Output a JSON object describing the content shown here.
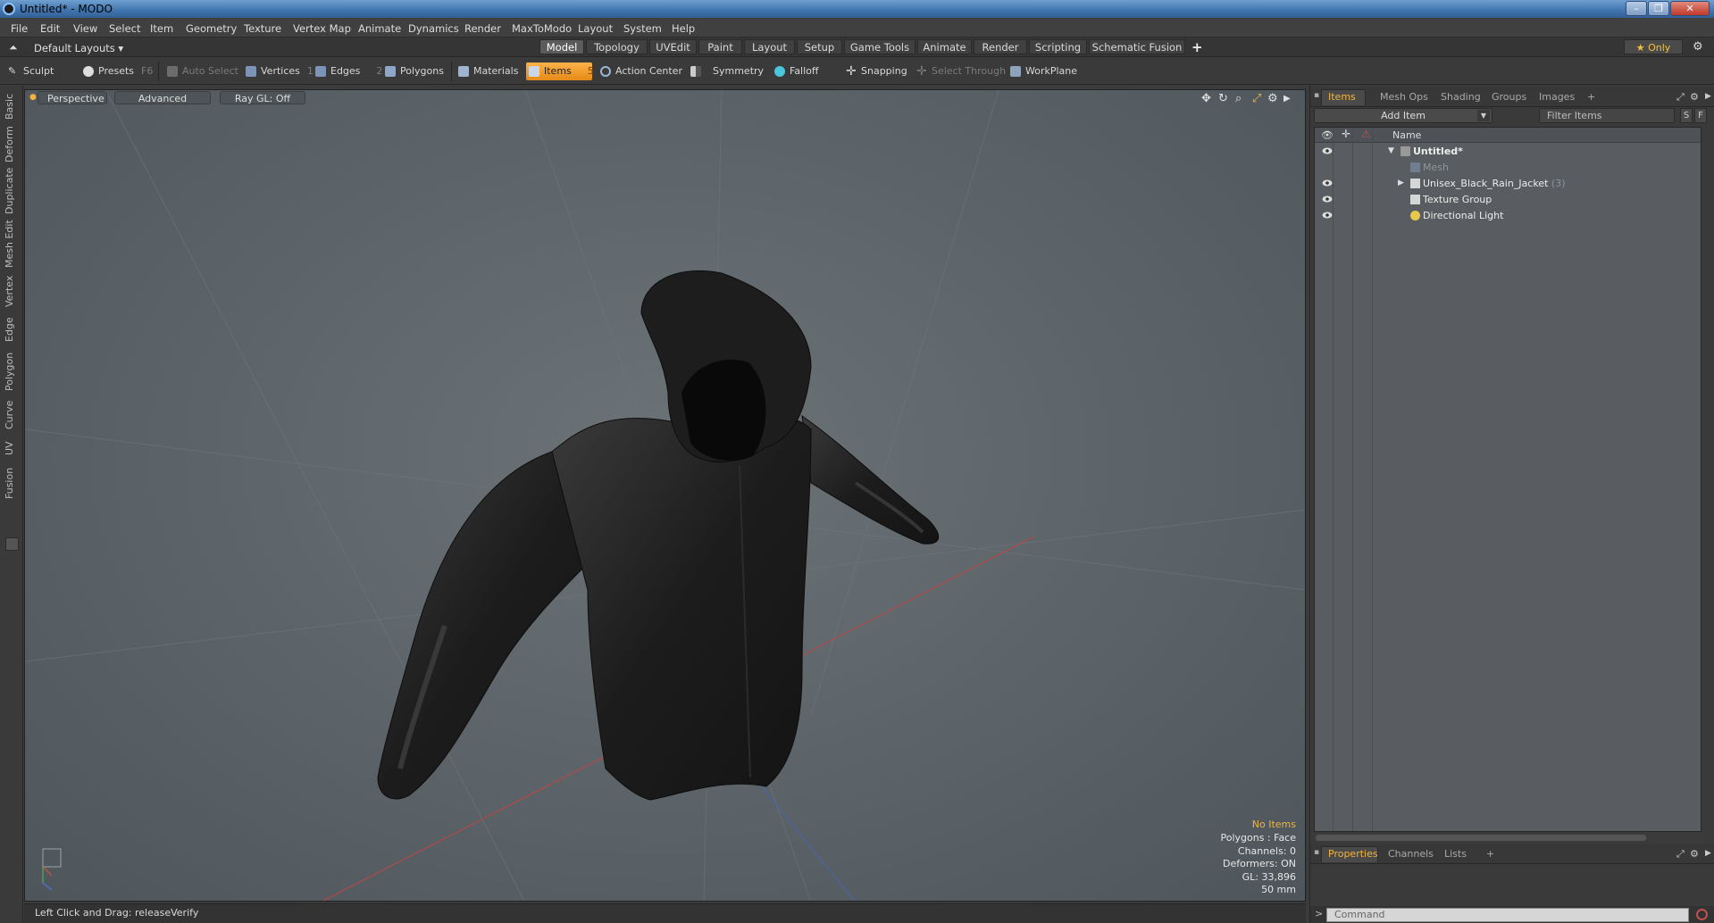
{
  "window": {
    "title": "Untitled* - MODO"
  },
  "menu": [
    "File",
    "Edit",
    "View",
    "Select",
    "Item",
    "Geometry",
    "Texture",
    "Vertex Map",
    "Animate",
    "Dynamics",
    "Render",
    "MaxToModo",
    "Layout",
    "System",
    "Help"
  ],
  "layouts": {
    "menu_label": "Default Layouts ▾",
    "tabs": [
      "Model",
      "Topology",
      "UVEdit",
      "Paint",
      "Layout",
      "Setup",
      "Game Tools",
      "Animate",
      "Render",
      "Scripting",
      "Schematic Fusion"
    ],
    "active_tab": "Model",
    "plus": "+",
    "only_label": "★  Only"
  },
  "toolbar": {
    "sculpt": "Sculpt",
    "presets": "Presets",
    "presets_key": "F6",
    "auto_select": "Auto Select",
    "vertices": "Vertices",
    "vertices_key": "1",
    "edges": "Edges",
    "edges_key": "2",
    "polygons": "Polygons",
    "materials": "Materials",
    "items": "Items",
    "items_key": "5",
    "action_center": "Action Center",
    "symmetry": "Symmetry",
    "falloff": "Falloff",
    "snapping": "Snapping",
    "select_through": "Select Through",
    "workplane": "WorkPlane"
  },
  "left_tabs": [
    "Basic",
    "Deform",
    "Duplicate",
    "Mesh Edit",
    "Vertex",
    "Edge",
    "Polygon",
    "Curve",
    "UV",
    "Fusion"
  ],
  "viewport": {
    "view_mode": "Perspective",
    "shading": "Advanced",
    "raygl": "Ray GL: Off",
    "stats": {
      "selection": "No Items",
      "polygons": "Polygons : Face",
      "channels": "Channels: 0",
      "deformers": "Deformers: ON",
      "gl": "GL: 33,896",
      "scale": "50 mm"
    }
  },
  "status": {
    "hint": "Left Click and Drag:   releaseVerify"
  },
  "items_panel": {
    "tabs": [
      "Items",
      "Mesh Ops",
      "Shading",
      "Groups",
      "Images",
      "+"
    ],
    "active_tab": "Items",
    "add_item": "Add Item",
    "filter_placeholder": "Filter Items",
    "btn_s": "S",
    "btn_f": "F",
    "column_name": "Name",
    "tree": [
      {
        "label": "Untitled*",
        "count": "",
        "bold": true,
        "dim": false
      },
      {
        "label": "Mesh",
        "count": "",
        "bold": false,
        "dim": true
      },
      {
        "label": "Unisex_Black_Rain_Jacket",
        "count": "(3)",
        "bold": false,
        "dim": false
      },
      {
        "label": "Texture Group",
        "count": "",
        "bold": false,
        "dim": false
      },
      {
        "label": "Directional Light",
        "count": "",
        "bold": false,
        "dim": false
      }
    ]
  },
  "properties_panel": {
    "tabs": [
      "Properties",
      "Channels",
      "Lists",
      "+"
    ],
    "active_tab": "Properties"
  },
  "command": {
    "placeholder": "Command"
  },
  "colors": {
    "accent": "#f2b33d",
    "active_tool": "#f29a25",
    "viewport_bg": "#5f676b"
  }
}
